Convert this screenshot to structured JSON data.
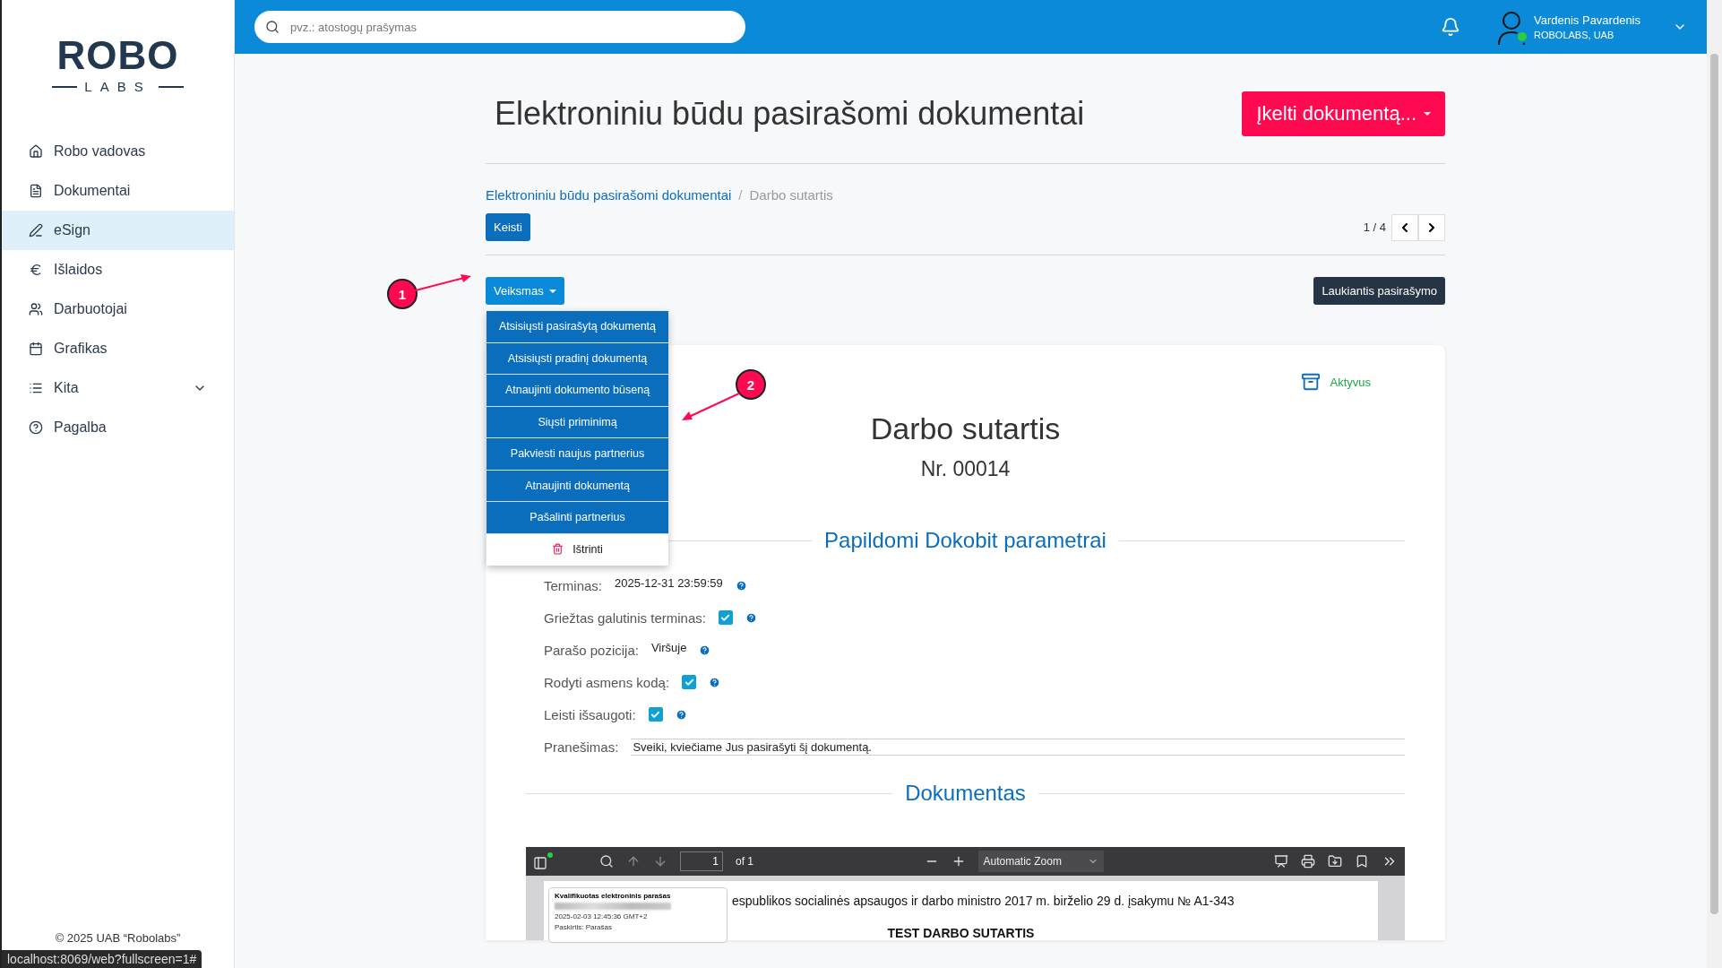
{
  "sidebar": {
    "logo": {
      "top": "ROBO",
      "bottom": "LABS"
    },
    "items": [
      {
        "label": "Robo vadovas",
        "selected": false
      },
      {
        "label": "Dokumentai",
        "selected": false
      },
      {
        "label": "eSign",
        "selected": true
      },
      {
        "label": "Išlaidos",
        "selected": false
      },
      {
        "label": "Darbuotojai",
        "selected": false
      },
      {
        "label": "Grafikas",
        "selected": false
      },
      {
        "label": "Kita",
        "selected": false,
        "expandable": true
      },
      {
        "label": "Pagalba",
        "selected": false
      }
    ],
    "footer": "© 2025 UAB “Robolabs”"
  },
  "topbar": {
    "search": {
      "placeholder": "pvz.: atostogų prašymas"
    },
    "user": {
      "name": "Vardenis Pavardenis",
      "company": "ROBOLABS, UAB",
      "online": true
    }
  },
  "page": {
    "title": "Elektroniniu būdu pasirašomi dokumentai",
    "upload_button": "Įkelti dokumentą...",
    "breadcrumb_separator": "/",
    "breadcrumb": [
      {
        "label": "Elektroniniu būdu pasirašomi dokumentai",
        "kind": "link"
      },
      {
        "label": "Darbo sutartis",
        "kind": "current"
      }
    ],
    "edit_button": "Keisti",
    "pager": "1 / 4",
    "actions_button": "Veiksmas",
    "status_button": "Laukiantis pasirašymo",
    "actions_menu": [
      {
        "label": "Atsisiųsti pasirašytą dokumentą",
        "kind": "action"
      },
      {
        "label": "Atsisiųsti pradinį dokumentą",
        "kind": "action"
      },
      {
        "label": "Atnaujinti dokumento būseną",
        "kind": "action"
      },
      {
        "label": "Siųsti priminimą",
        "kind": "action"
      },
      {
        "label": "Pakviesti naujus partnerius",
        "kind": "action"
      },
      {
        "label": "Atnaujinti dokumentą",
        "kind": "action"
      },
      {
        "label": "Pašalinti partnerius",
        "kind": "action"
      },
      {
        "label": "Ištrinti",
        "kind": "delete"
      }
    ],
    "annotations": [
      "1",
      "2"
    ]
  },
  "document": {
    "state": "Aktyvus",
    "title": "Darbo sutartis",
    "number": "Nr. 00014",
    "params_heading": "Papildomi Dokobit parametrai",
    "params": [
      {
        "label": "Terminas:",
        "kind": "text",
        "value": "2025-12-31 23:59:59",
        "help": true
      },
      {
        "label": "Griežtas galutinis terminas:",
        "kind": "checkbox",
        "checked": true,
        "help": true
      },
      {
        "label": "Parašo pozicija:",
        "kind": "text",
        "value": "Viršuje",
        "help": true
      },
      {
        "label": "Rodyti asmens kodą:",
        "kind": "checkbox",
        "checked": true,
        "help": true
      },
      {
        "label": "Leisti išsaugoti:",
        "kind": "checkbox",
        "checked": true,
        "help": true
      },
      {
        "label": "Pranešimas:",
        "kind": "field",
        "value": "Sveiki, kviečiame Jus pasirašyti šį dokumentą."
      }
    ],
    "doc_heading": "Dokumentas",
    "viewer": {
      "page_input": "1",
      "page_count": "of 1",
      "zoom": "Automatic Zoom",
      "stamp": {
        "title": "Kvalifikuotas elektroninis parašas",
        "date": "2025-02-03 12:45:36 GMT+2",
        "purpose": "Paskirtis: Parašas"
      },
      "lines": [
        {
          "text": "espublikos socialinės apsaugos ir darbo ministro 2017 m. birželio 29 d. įsakymu № A1-343",
          "kind": "normal"
        },
        {
          "text": "TEST DARBO SUTARTIS",
          "kind": "heading"
        }
      ]
    }
  },
  "status_url": "localhost:8069/web?fullscreen=1#"
}
